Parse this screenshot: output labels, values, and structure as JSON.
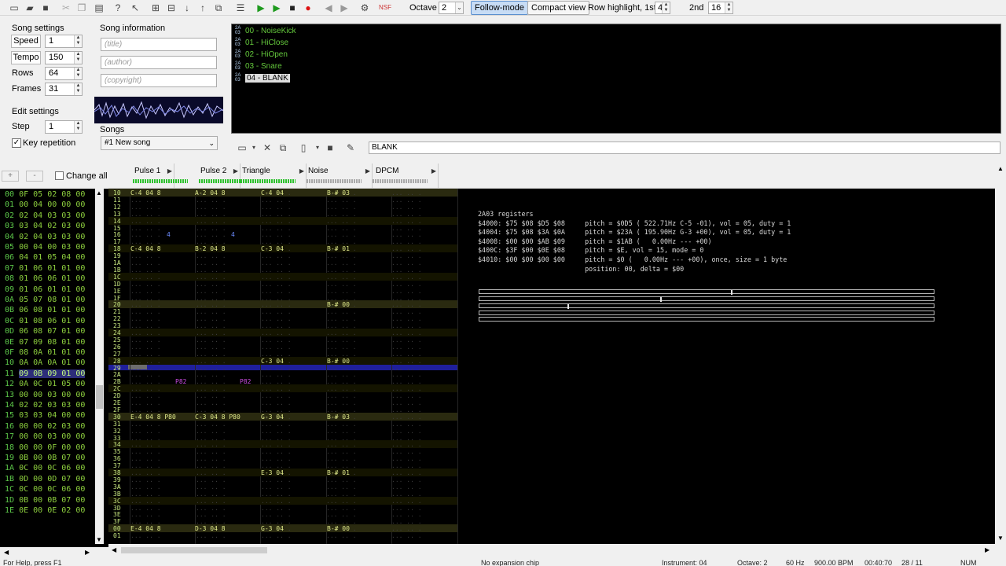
{
  "toolbar": {
    "octave_label": "Octave",
    "octave_value": "2",
    "follow_mode": "Follow-mode",
    "compact_view": "Compact view",
    "row_highlight_label": "Row highlight, 1st",
    "row_highlight_1st": "4",
    "second_label": "2nd",
    "row_highlight_2nd": "16",
    "nsf": "NSF"
  },
  "song_settings": {
    "title": "Song settings",
    "speed_label": "Speed",
    "speed": "1",
    "tempo_label": "Tempo",
    "tempo": "150",
    "rows_label": "Rows",
    "rows": "64",
    "frames_label": "Frames",
    "frames": "31"
  },
  "edit_settings": {
    "title": "Edit settings",
    "step_label": "Step",
    "step": "1",
    "key_repetition": "Key repetition"
  },
  "song_info": {
    "title": "Song information",
    "title_placeholder": "(title)",
    "author_placeholder": "(author)",
    "copyright_placeholder": "(copyright)"
  },
  "songs": {
    "label": "Songs",
    "selected": "#1 New song"
  },
  "instruments": [
    {
      "name": "00 - NoiseKick"
    },
    {
      "name": "01 - HiClose"
    },
    {
      "name": "02 - HiOpen"
    },
    {
      "name": "03 - Snare"
    },
    {
      "name": "04 - BLANK",
      "selected": true
    }
  ],
  "instrument_name_field": "BLANK",
  "frame_controls": {
    "add": "+",
    "remove": "-",
    "change_all": "Change all"
  },
  "channels": [
    "Pulse 1",
    "Pulse 2",
    "Triangle",
    "Noise",
    "DPCM"
  ],
  "frames": [
    {
      "n": "00",
      "d": "0F 05 02 08 00"
    },
    {
      "n": "01",
      "d": "00 04 00 00 00"
    },
    {
      "n": "02",
      "d": "02 04 03 03 00"
    },
    {
      "n": "03",
      "d": "03 04 02 03 00"
    },
    {
      "n": "04",
      "d": "02 04 03 03 00"
    },
    {
      "n": "05",
      "d": "00 04 00 03 00"
    },
    {
      "n": "06",
      "d": "04 01 05 04 00"
    },
    {
      "n": "07",
      "d": "01 06 01 01 00"
    },
    {
      "n": "08",
      "d": "01 06 06 01 00"
    },
    {
      "n": "09",
      "d": "01 06 01 01 00"
    },
    {
      "n": "0A",
      "d": "05 07 08 01 00"
    },
    {
      "n": "0B",
      "d": "06 08 01 01 00"
    },
    {
      "n": "0C",
      "d": "01 08 06 01 00"
    },
    {
      "n": "0D",
      "d": "06 08 07 01 00"
    },
    {
      "n": "0E",
      "d": "07 09 08 01 00"
    },
    {
      "n": "0F",
      "d": "08 0A 01 01 00"
    },
    {
      "n": "10",
      "d": "0A 0A 0A 01 00"
    },
    {
      "n": "11",
      "d": "09 0B 09 01 00",
      "current": true
    },
    {
      "n": "12",
      "d": "0A 0C 01 05 00"
    },
    {
      "n": "13",
      "d": "00 00 03 00 00"
    },
    {
      "n": "14",
      "d": "02 02 03 03 00"
    },
    {
      "n": "15",
      "d": "03 03 04 00 00"
    },
    {
      "n": "16",
      "d": "00 00 02 03 00"
    },
    {
      "n": "17",
      "d": "00 00 03 00 00"
    },
    {
      "n": "18",
      "d": "00 00 0F 00 00"
    },
    {
      "n": "19",
      "d": "0B 00 0B 07 00"
    },
    {
      "n": "1A",
      "d": "0C 00 0C 06 00"
    },
    {
      "n": "1B",
      "d": "0D 00 0D 07 00"
    },
    {
      "n": "1C",
      "d": "0C 00 0C 06 00"
    },
    {
      "n": "1D",
      "d": "0B 00 0B 07 00"
    },
    {
      "n": "1E",
      "d": "0E 00 0E 02 00"
    }
  ],
  "pattern_rows": [
    "10",
    "11",
    "12",
    "13",
    "14",
    "15",
    "16",
    "17",
    "18",
    "19",
    "1A",
    "1B",
    "1C",
    "1D",
    "1E",
    "1F",
    "20",
    "21",
    "22",
    "23",
    "24",
    "25",
    "26",
    "27",
    "28",
    "29",
    "2A",
    "2B",
    "2C",
    "2D",
    "2E",
    "2F",
    "30",
    "31",
    "32",
    "33",
    "34",
    "35",
    "36",
    "37",
    "38",
    "39",
    "3A",
    "3B",
    "3C",
    "3D",
    "3E",
    "3F",
    "00",
    "01"
  ],
  "pattern_notes": [
    {
      "r": 0,
      "t": "C-4 04 8",
      "c": 0
    },
    {
      "r": 0,
      "t": "A-2 04 8",
      "c": 1
    },
    {
      "r": 0,
      "t": "C-4 04",
      "c": 2
    },
    {
      "r": 0,
      "t": "B-# 03",
      "c": 3
    },
    {
      "r": 6,
      "t": "4",
      "c": 0,
      "inst": true
    },
    {
      "r": 6,
      "t": "4",
      "c": 1,
      "inst": true
    },
    {
      "r": 8,
      "t": "C-4 04 8",
      "c": 0
    },
    {
      "r": 8,
      "t": "B-2 04 8",
      "c": 1
    },
    {
      "r": 8,
      "t": "C-3 04",
      "c": 2
    },
    {
      "r": 8,
      "t": "B-# 01",
      "c": 3
    },
    {
      "r": 16,
      "t": "B-# 00",
      "c": 3
    },
    {
      "r": 24,
      "t": "C-3 04",
      "c": 2
    },
    {
      "r": 24,
      "t": "B-# 00",
      "c": 3
    },
    {
      "r": 27,
      "t": "P82",
      "c": 0,
      "eff": true
    },
    {
      "r": 27,
      "t": "P82",
      "c": 1,
      "eff": true
    },
    {
      "r": 32,
      "t": "E-4 04 8 P80",
      "c": 0
    },
    {
      "r": 32,
      "t": "C-3 04 8 P80",
      "c": 1
    },
    {
      "r": 32,
      "t": "G-3 04",
      "c": 2
    },
    {
      "r": 32,
      "t": "B-# 03",
      "c": 3
    },
    {
      "r": 40,
      "t": "E-3 04",
      "c": 2
    },
    {
      "r": 40,
      "t": "B-# 01",
      "c": 3
    },
    {
      "r": 48,
      "t": "E-4 04 8",
      "c": 0
    },
    {
      "r": 48,
      "t": "D-3 04 8",
      "c": 1
    },
    {
      "r": 48,
      "t": "G-3 04",
      "c": 2
    },
    {
      "r": 48,
      "t": "B-# 00",
      "c": 3
    }
  ],
  "registers": {
    "title": "2A03 registers",
    "lines": [
      "$4000: $75 $08 $D5 $08     pitch = $0D5 ( 522.71Hz C-5 -01), vol = 05, duty = 1",
      "$4004: $75 $08 $3A $0A     pitch = $23A ( 195.90Hz G-3 +00), vol = 05, duty = 1",
      "$4008: $00 $00 $AB $09     pitch = $1AB (   0.00Hz --- +00)",
      "$400C: $3F $00 $0E $08     pitch = $E, vol = 15, mode = 0",
      "$4010: $00 $00 $00 $00     pitch = $0 (   0.00Hz --- +00), once, size = 1 byte",
      "                           position: 00, delta = $00"
    ]
  },
  "status": {
    "help": "For Help, press F1",
    "chip": "No expansion chip",
    "instrument": "Instrument: 04",
    "octave": "Octave: 2",
    "rate": "60 Hz",
    "tempo": "900.00 BPM",
    "time": "00:40:70",
    "position": "28 / 11",
    "num": "NUM"
  },
  "colors": {
    "accent": "#5b8fce",
    "pattern_bg": "#000000",
    "cursor_row": "#1f1f9a",
    "note": "#e0ea8a",
    "instrument": "#6d8cff",
    "frame_text": "#8dcf3e"
  }
}
